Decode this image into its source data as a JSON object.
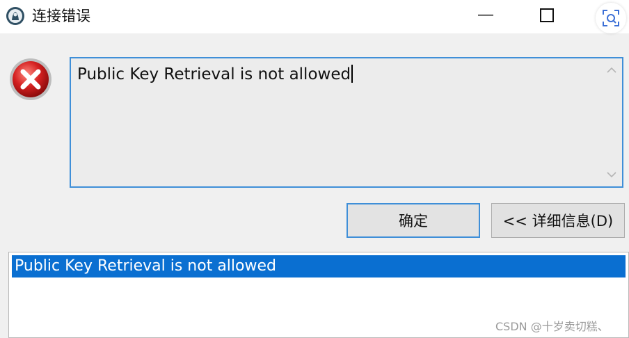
{
  "window": {
    "title": "连接错误"
  },
  "message": {
    "text": "Public Key Retrieval is not allowed"
  },
  "buttons": {
    "ok_label": "确定",
    "details_label": "<< 详细信息(D)"
  },
  "detail_list": {
    "items": [
      "Public Key Retrieval is not allowed"
    ]
  },
  "watermark": "CSDN @十岁卖切糕、",
  "colors": {
    "accent": "#3f8fd8",
    "selection": "#0a6fd1",
    "error_red": "#d42020"
  }
}
